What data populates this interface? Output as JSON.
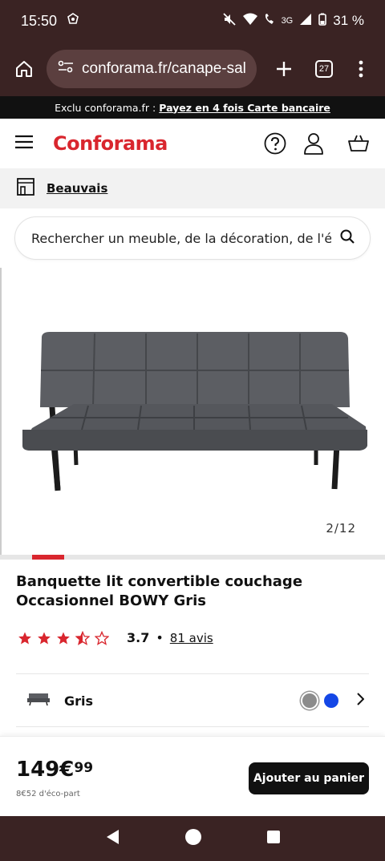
{
  "status_bar": {
    "time": "15:50",
    "network": "3G",
    "battery": "31 %"
  },
  "browser": {
    "url": "conforama.fr/canape-sal",
    "tabs_count": "27"
  },
  "promo": {
    "prefix": "Exclu conforama.fr :",
    "link": "Payez en 4 fois Carte bancaire"
  },
  "header": {
    "brand": "Conforama"
  },
  "store": {
    "name": "Beauvais"
  },
  "search": {
    "placeholder": "Rechercher un meuble, de la décoration, de l'él"
  },
  "gallery": {
    "counter": "2/12",
    "progress_fraction": 0.167
  },
  "product": {
    "title": "Banquette lit convertible couchage Occasionnel BOWY Gris",
    "rating": 3.7,
    "rating_text": "3.7",
    "rating_separator": "•",
    "reviews": "81 avis",
    "color_label": "Gris",
    "colors": [
      "#8c8c8c",
      "#1447e6"
    ]
  },
  "price": {
    "main": "149€",
    "cents": "99",
    "eco": "8€52 d'éco-part"
  },
  "cart": {
    "label": "Ajouter au panier"
  },
  "theme": {
    "brand_red": "#d9262e",
    "chrome": "#3a2323"
  }
}
